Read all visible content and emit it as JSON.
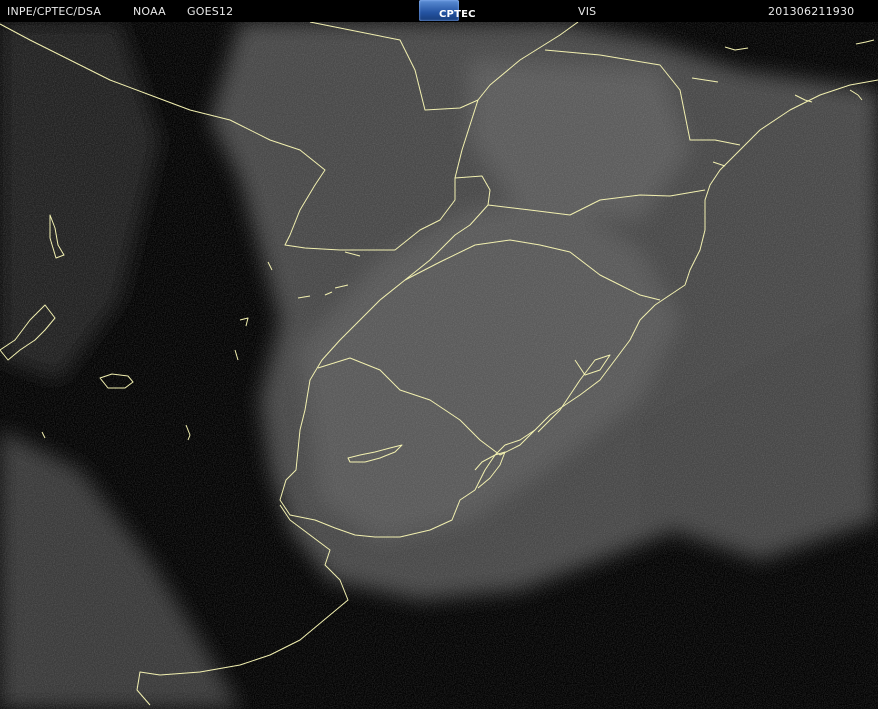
{
  "header": {
    "source": "INPE/CPTEC/DSA",
    "agency": "NOAA",
    "satellite": "GOES12",
    "logo_text": "CPTEC",
    "channel": "VIS",
    "timestamp": "201306211930"
  },
  "map": {
    "imagery": "visible-channel-satellite",
    "background_color": "#000000",
    "cloud_color": "#8a8a8a",
    "border_color": "#f2f0b0"
  }
}
